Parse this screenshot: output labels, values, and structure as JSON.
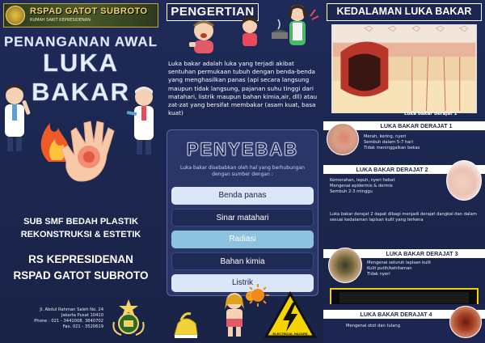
{
  "panel1": {
    "logo_text": "RSPAD GATOT SUBROTO",
    "logo_sub": "RUMAH SAKIT KEPRESIDENAN",
    "title_line1": "PENANGANAN AWAL",
    "title_line2": "LUKA BAKAR",
    "sub_line1": "SUB SMF BEDAH PLASTIK",
    "sub_line2": "REKONSTRUKSI & ESTETIK",
    "rs_line1": "RS KEPRESIDENAN",
    "rs_line2": "RSPAD GATOT SUBROTO",
    "address": [
      "Jl. Abdul Rahman Saleh No. 24",
      "Jakarta Pusat 10410",
      "Phone : 021 - 3441008, 3840702",
      "Fax. 021 - 3520619"
    ]
  },
  "panel2": {
    "pengertian_title": "PENGERTIAN",
    "pengertian_text": "Luka bakar adalah luka yang terjadi akibat sentuhan permukaan tubuh dengan benda-benda yang menghasilkan panas (api secara langsung maupun tidak langsung, pajanan suhu tinggi dari matahari, listrik maupun bahan kimia,air, dll) atau zat-zat yang bersifat membakar (asam kuat, basa kuat)",
    "penyebab_title": "PENYEBAB",
    "penyebab_intro": "Luka bakar disebabkan oleh hal yang berhubungan dengan sumber dengan :",
    "causes": [
      "Benda panas",
      "Sinar matahari",
      "Radiasi",
      "Bahan kimia",
      "Listrik"
    ],
    "warning_sign_text": "ELECTRICAL HAZARD"
  },
  "panel3": {
    "kedalaman_title": "KEDALAMAN LUKA BAKAR",
    "skin_caption": "Luka bakar derajat 1",
    "degrees": [
      {
        "label": "LUKA BAKAR DERAJAT 1",
        "desc": [
          "Merah, kering, nyeri",
          "Sembuh dalam 5-7 hari",
          "Tidak meninggalkan bekas"
        ]
      },
      {
        "label": "LUKA BAKAR DERAJAT 2",
        "desc": [
          "Kemerahan, lepuh, nyeri hebat",
          "Mengenai epidermis & dermis",
          "Sembuh 2-3 minggu"
        ]
      },
      {
        "label": "LUKA BAKAR DERAJAT 3",
        "desc": [
          "Mengenai seluruh lapisan kulit",
          "Kulit putih/kehitaman",
          "Tidak nyeri"
        ]
      },
      {
        "label": "LUKA BAKAR DERAJAT 4",
        "desc": [
          "Mengenai otot dan tulang"
        ]
      }
    ],
    "mid_text": "Luka bakar derajat 2 dapat dibagi menjadi derajat dangkal dan dalam sesuai kedalaman lapisan kulit yang terkena"
  },
  "colors": {
    "navy": "#1c2650",
    "light_pill": "#dbe6f6",
    "mid_pill": "#8ec3e0",
    "gold": "#f4d264"
  }
}
